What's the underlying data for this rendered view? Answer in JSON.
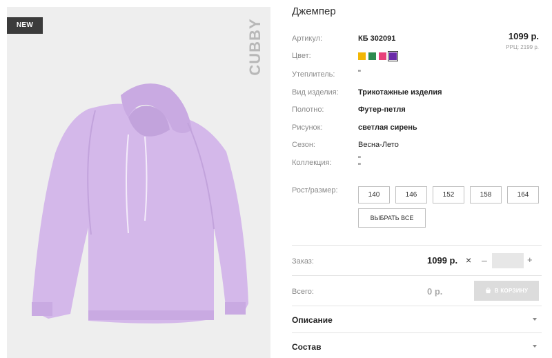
{
  "badge": "NEW",
  "brand": "CUBBY",
  "product": {
    "title": "Джемпер",
    "price": "1099 р.",
    "rrp": "РРЦ: 2199 р."
  },
  "attributes": [
    {
      "label": "Артикул:",
      "value": "КБ 302091"
    },
    {
      "label": "Цвет:",
      "value": ""
    },
    {
      "label": "Утеплитель:",
      "value": "\""
    },
    {
      "label": "Вид изделия:",
      "value": "Трикотажные изделия"
    },
    {
      "label": "Полотно:",
      "value": "Футер-петля"
    },
    {
      "label": "Рисунок:",
      "value": "светлая сирень"
    },
    {
      "label": "Сезон:",
      "value": "Весна-Лето"
    },
    {
      "label": "Коллекция:",
      "value": "\"\n\""
    }
  ],
  "colors": [
    {
      "name": "yellow",
      "hex": "#f2b705",
      "selected": false
    },
    {
      "name": "green",
      "hex": "#2e8b4f",
      "selected": false
    },
    {
      "name": "pink",
      "hex": "#e8407a",
      "selected": false
    },
    {
      "name": "purple",
      "hex": "#6a2aa8",
      "selected": true
    }
  ],
  "sizes": {
    "label": "Рост/размер:",
    "options": [
      "140",
      "146",
      "152",
      "158",
      "164"
    ],
    "select_all": "ВЫБРАТЬ ВСЕ"
  },
  "order": {
    "label": "Заказ:",
    "price": "1099 р.",
    "times": "×",
    "minus": "–",
    "plus": "+",
    "quantity": ""
  },
  "total": {
    "label": "Всего:",
    "value": "0 р.",
    "cart_button": "В КОРЗИНУ",
    "cart_icon": "basket-icon"
  },
  "accordion": [
    {
      "title": "Описание",
      "icon": "chevron-down-icon"
    },
    {
      "title": "Состав",
      "icon": "chevron-down-icon"
    }
  ],
  "palette": {
    "garment": "#d4b8ea",
    "garment_shadow": "#c2a3dc",
    "image_bg": "#eeeeee"
  }
}
